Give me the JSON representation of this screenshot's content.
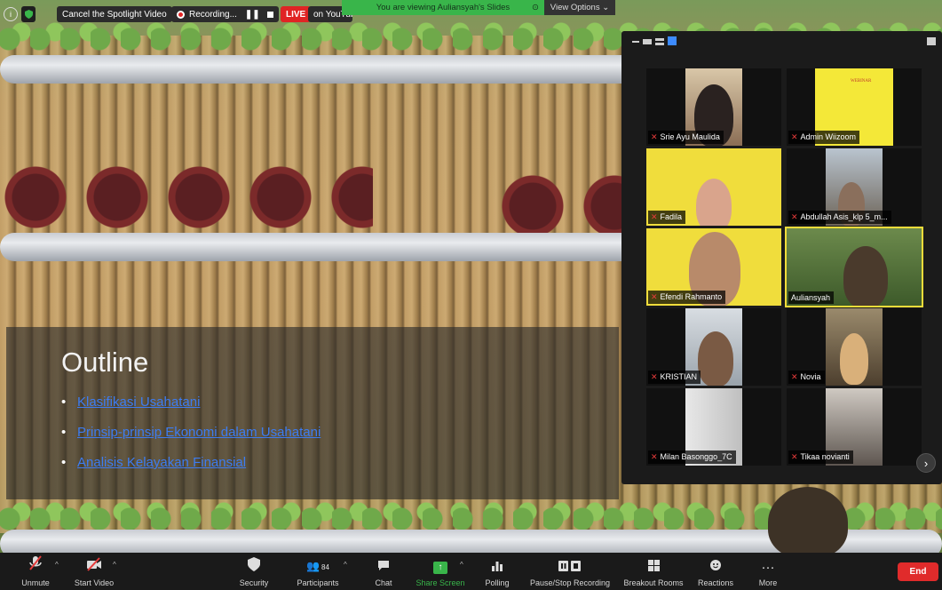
{
  "window": {
    "banner_text": "You are viewing Auliansyah's Slides",
    "view_options": "View Options ⌄"
  },
  "topbar": {
    "spotlight_label": "Cancel the Spotlight Video",
    "recording_label": "Recording...",
    "live_badge": "LIVE",
    "live_label": "on YouTube"
  },
  "slide": {
    "title": "Outline",
    "bullets": [
      "Klasifikasi Usahatani",
      "Prinsip-prinsip Ekonomi dalam Usahatani",
      "Analisis Kelayakan Finansial"
    ]
  },
  "gallery": {
    "participants": [
      {
        "name": "Srie Ayu Maulida",
        "muted": true
      },
      {
        "name": "Admin Wiizoom",
        "muted": true
      },
      {
        "name": "Fadila",
        "muted": true
      },
      {
        "name": "Abdullah Asis_klp 5_m...",
        "muted": true
      },
      {
        "name": "Efendi Rahmanto",
        "muted": true
      },
      {
        "name": "Auliansyah",
        "muted": false
      },
      {
        "name": "KRISTIAN",
        "muted": true
      },
      {
        "name": "Novia",
        "muted": true
      },
      {
        "name": "Milan Basonggo_7C",
        "muted": true
      },
      {
        "name": "Tikaa novianti",
        "muted": true
      }
    ]
  },
  "toolbar": {
    "unmute": "Unmute",
    "start_video": "Start Video",
    "security": "Security",
    "participants": "Participants",
    "participants_count": "84",
    "chat": "Chat",
    "share_screen": "Share Screen",
    "polling": "Polling",
    "pause_recording": "Pause/Stop Recording",
    "breakout_rooms": "Breakout Rooms",
    "reactions": "Reactions",
    "more": "More",
    "end": "End"
  },
  "colors": {
    "accent_green": "#39b54a",
    "end_red": "#e02b2b",
    "live_red": "#e02424",
    "active_speaker": "#f0dc3a"
  }
}
